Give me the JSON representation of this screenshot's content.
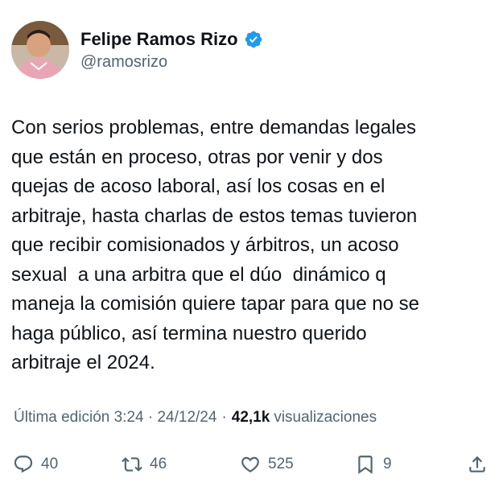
{
  "author": {
    "display_name": "Felipe Ramos Rizo",
    "handle": "@ramosrizo",
    "verified": true
  },
  "tweet": {
    "text": "Con serios problemas, entre demandas legales\nque están en proceso, otras por venir y dos\nquejas de acoso laboral, así los cosas en el\narbitraje, hasta charlas de estos temas tuvieron\nque recibir comisionados y árbitros, un acoso\nsexual  a una arbitra que el dúo  dinámico q\nmaneja la comisión quiere tapar para que no se\nhaga público, así termina nuestro querido\narbitraje el 2024."
  },
  "meta": {
    "edited_label": "Última edición 3:24 · 24/12/24",
    "separator": "·",
    "views_count": "42,1k",
    "views_label": "visualizaciones"
  },
  "actions": {
    "replies": "40",
    "retweets": "46",
    "likes": "525",
    "bookmarks": "9"
  },
  "icons": {
    "verified": "verified-badge-icon",
    "reply": "reply-icon",
    "retweet": "retweet-icon",
    "like": "heart-icon",
    "bookmark": "bookmark-icon",
    "share": "share-icon"
  },
  "colors": {
    "text_primary": "#0f1419",
    "text_secondary": "#536471",
    "verified_blue": "#1d9bf0"
  }
}
